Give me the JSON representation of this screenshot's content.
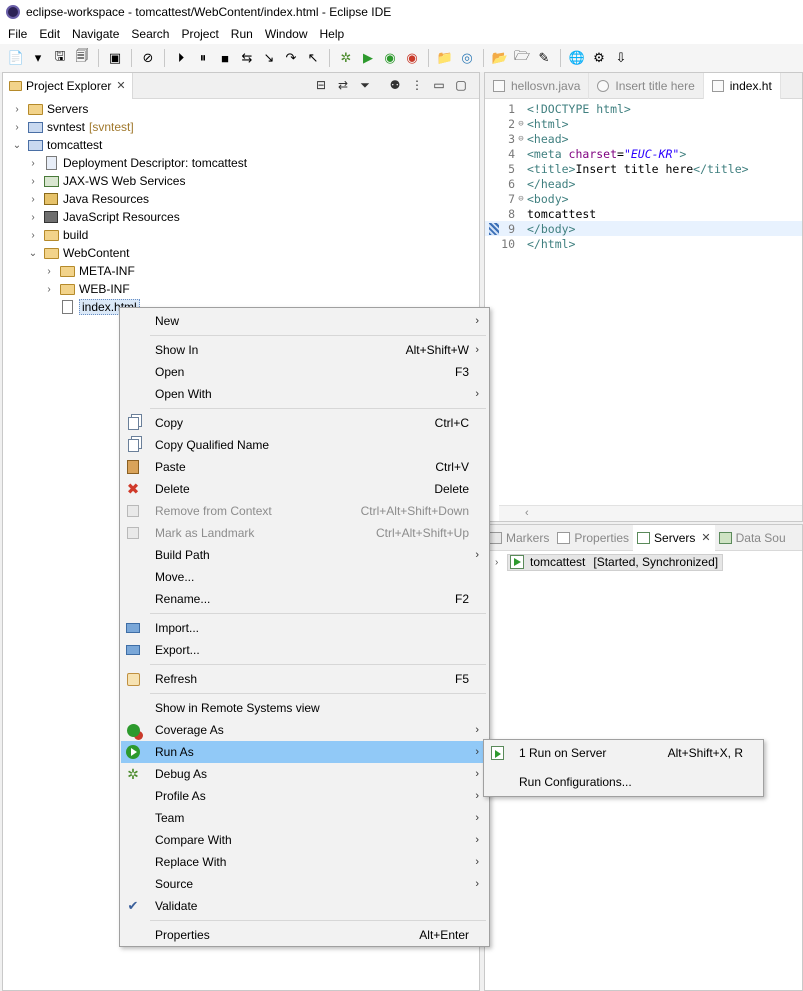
{
  "window": {
    "title": "eclipse-workspace - tomcattest/WebContent/index.html - Eclipse IDE"
  },
  "menubar": [
    "File",
    "Edit",
    "Navigate",
    "Search",
    "Project",
    "Run",
    "Window",
    "Help"
  ],
  "explorer": {
    "tab_label": "Project Explorer",
    "tree": [
      {
        "label": "Servers",
        "deco": "",
        "icon": "folder-icon",
        "depth": 0,
        "chevron": "›"
      },
      {
        "label": "svntest",
        "deco": "[svntest]",
        "icon": "project-icon",
        "depth": 0,
        "chevron": "›"
      },
      {
        "label": "tomcattest",
        "deco": "",
        "icon": "project-icon",
        "depth": 0,
        "chevron": "⌄"
      },
      {
        "label": "Deployment Descriptor: tomcattest",
        "deco": "",
        "icon": "descriptor-icon",
        "depth": 1,
        "chevron": "›"
      },
      {
        "label": "JAX-WS Web Services",
        "deco": "",
        "icon": "web-services-icon",
        "depth": 1,
        "chevron": "›"
      },
      {
        "label": "Java Resources",
        "deco": "",
        "icon": "java-resources-icon",
        "depth": 1,
        "chevron": "›"
      },
      {
        "label": "JavaScript Resources",
        "deco": "",
        "icon": "javascript-resources-icon",
        "depth": 1,
        "chevron": "›"
      },
      {
        "label": "build",
        "deco": "",
        "icon": "folder-icon",
        "depth": 1,
        "chevron": "›"
      },
      {
        "label": "WebContent",
        "deco": "",
        "icon": "folder-icon",
        "depth": 1,
        "chevron": "⌄"
      },
      {
        "label": "META-INF",
        "deco": "",
        "icon": "folder-icon",
        "depth": 2,
        "chevron": "›"
      },
      {
        "label": "WEB-INF",
        "deco": "",
        "icon": "folder-icon",
        "depth": 2,
        "chevron": "›"
      },
      {
        "label": "index.html",
        "deco": "",
        "icon": "html-file-icon",
        "depth": 2,
        "chevron": ""
      }
    ]
  },
  "editor": {
    "tabs": [
      "hellosvn.java",
      "Insert title here",
      "index.ht"
    ],
    "lines": [
      {
        "num": "1",
        "fold": "",
        "text": "<!DOCTYPE html>"
      },
      {
        "num": "2",
        "fold": "⊖",
        "text": "<html>"
      },
      {
        "num": "3",
        "fold": "⊖",
        "text": "<head>"
      },
      {
        "num": "4",
        "fold": "",
        "text": "<meta charset=\"EUC-KR\">"
      },
      {
        "num": "5",
        "fold": "",
        "text": "<title>Insert title here</title>"
      },
      {
        "num": "6",
        "fold": "",
        "text": "</head>"
      },
      {
        "num": "7",
        "fold": "⊖",
        "text": "<body>"
      },
      {
        "num": "8",
        "fold": "",
        "text": "tomcattest"
      },
      {
        "num": "9",
        "fold": "",
        "text": "</body>"
      },
      {
        "num": "10",
        "fold": "",
        "text": "</html>"
      }
    ]
  },
  "servers_view": {
    "tabs": [
      "Markers",
      "Properties",
      "Servers",
      "Data Sou"
    ],
    "server_name": "tomcattest",
    "server_status": "[Started, Synchronized]"
  },
  "context_menu": {
    "items": [
      {
        "label": "New",
        "shortcut": "",
        "submenu": true
      },
      {
        "label": "Show In",
        "shortcut": "Alt+Shift+W",
        "submenu": true
      },
      {
        "label": "Open",
        "shortcut": "F3",
        "submenu": false
      },
      {
        "label": "Open With",
        "shortcut": "",
        "submenu": true
      },
      {
        "label": "Copy",
        "shortcut": "Ctrl+C",
        "submenu": false
      },
      {
        "label": "Copy Qualified Name",
        "shortcut": "",
        "submenu": false
      },
      {
        "label": "Paste",
        "shortcut": "Ctrl+V",
        "submenu": false
      },
      {
        "label": "Delete",
        "shortcut": "Delete",
        "submenu": false
      },
      {
        "label": "Remove from Context",
        "shortcut": "Ctrl+Alt+Shift+Down",
        "submenu": false
      },
      {
        "label": "Mark as Landmark",
        "shortcut": "Ctrl+Alt+Shift+Up",
        "submenu": false
      },
      {
        "label": "Build Path",
        "shortcut": "",
        "submenu": true
      },
      {
        "label": "Move...",
        "shortcut": "",
        "submenu": false
      },
      {
        "label": "Rename...",
        "shortcut": "F2",
        "submenu": false
      },
      {
        "label": "Import...",
        "shortcut": "",
        "submenu": false
      },
      {
        "label": "Export...",
        "shortcut": "",
        "submenu": false
      },
      {
        "label": "Refresh",
        "shortcut": "F5",
        "submenu": false
      },
      {
        "label": "Show in Remote Systems view",
        "shortcut": "",
        "submenu": false
      },
      {
        "label": "Coverage As",
        "shortcut": "",
        "submenu": true
      },
      {
        "label": "Run As",
        "shortcut": "",
        "submenu": true
      },
      {
        "label": "Debug As",
        "shortcut": "",
        "submenu": true
      },
      {
        "label": "Profile As",
        "shortcut": "",
        "submenu": true
      },
      {
        "label": "Team",
        "shortcut": "",
        "submenu": true
      },
      {
        "label": "Compare With",
        "shortcut": "",
        "submenu": true
      },
      {
        "label": "Replace With",
        "shortcut": "",
        "submenu": true
      },
      {
        "label": "Source",
        "shortcut": "",
        "submenu": true
      },
      {
        "label": "Validate",
        "shortcut": "",
        "submenu": false
      },
      {
        "label": "Properties",
        "shortcut": "Alt+Enter",
        "submenu": false
      }
    ],
    "arrow": "›"
  },
  "run_as_submenu": {
    "items": [
      {
        "label": "1 Run on Server",
        "shortcut": "Alt+Shift+X, R"
      },
      {
        "label": "Run Configurations...",
        "shortcut": ""
      }
    ]
  },
  "colors": {
    "highlight": "#91c9f7",
    "selection": "#dbe9f8",
    "menu_bg": "#f2f2f2"
  }
}
